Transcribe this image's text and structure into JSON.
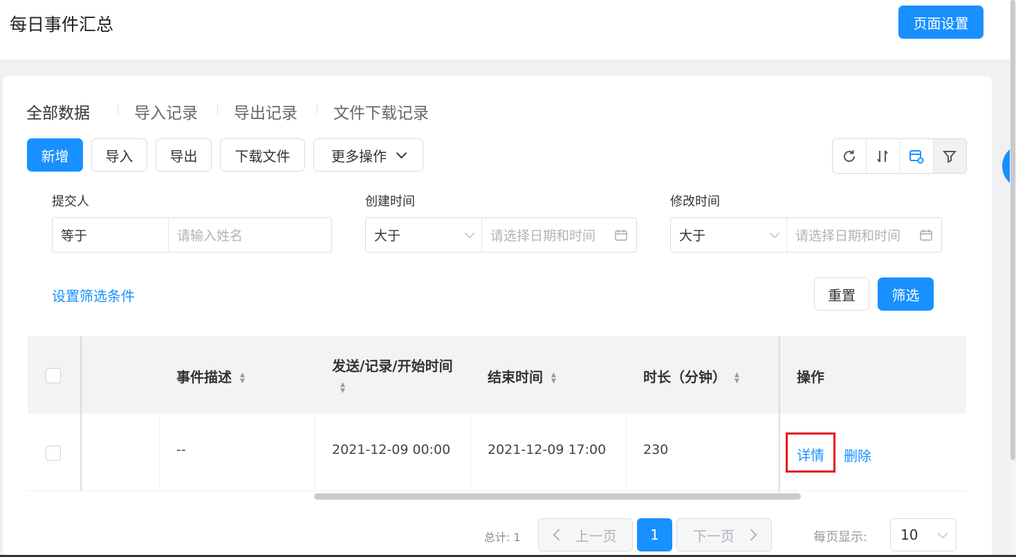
{
  "header": {
    "title": "每日事件汇总",
    "settings_button": "页面设置"
  },
  "tabs": [
    "全部数据",
    "导入记录",
    "导出记录",
    "文件下载记录"
  ],
  "toolbar": {
    "add": "新增",
    "import": "导入",
    "export": "导出",
    "download": "下载文件",
    "more": "更多操作"
  },
  "filters": [
    {
      "label": "提交人",
      "operator": "等于",
      "placeholder": "请输入姓名"
    },
    {
      "label": "创建时间",
      "operator": "大于",
      "placeholder": "请选择日期和时间"
    },
    {
      "label": "修改时间",
      "operator": "大于",
      "placeholder": "请选择日期和时间"
    }
  ],
  "filter_actions": {
    "set_conditions": "设置筛选条件",
    "reset": "重置",
    "filter": "筛选"
  },
  "table": {
    "columns": [
      "事件描述",
      "发送/记录/开始时间",
      "结束时间",
      "时长（分钟）",
      "操作"
    ],
    "rows": [
      {
        "description": "--",
        "start": "2021-12-09 00:00",
        "end": "2021-12-09 17:00",
        "duration": "230",
        "action_detail": "详情",
        "action_delete": "删除"
      }
    ]
  },
  "pagination": {
    "total": "总计: 1",
    "prev": "上一页",
    "current": "1",
    "next": "下一页",
    "per_page_label": "每页显示:",
    "per_page_value": "10"
  },
  "colors": {
    "primary": "#1890ff",
    "highlight": "#e5141a"
  }
}
